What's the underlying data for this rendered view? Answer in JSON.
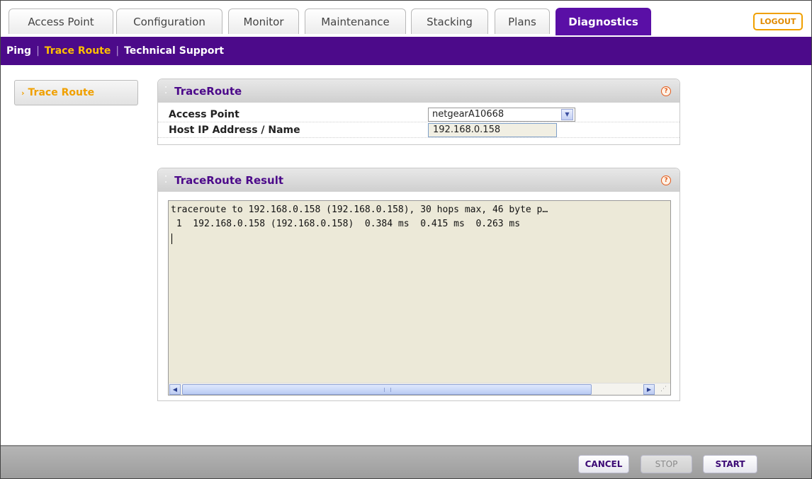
{
  "tabs": [
    {
      "label": "Access Point"
    },
    {
      "label": "Configuration"
    },
    {
      "label": "Monitor"
    },
    {
      "label": "Maintenance"
    },
    {
      "label": "Stacking"
    },
    {
      "label": "Plans"
    },
    {
      "label": "Diagnostics",
      "active": true
    }
  ],
  "logout_label": "LOGOUT",
  "subnav": {
    "items": [
      "Ping",
      "Trace Route",
      "Technical Support"
    ],
    "current": "Trace Route"
  },
  "sidebar": {
    "items": [
      {
        "label": "Trace Route",
        "active": true
      }
    ]
  },
  "traceroute_panel": {
    "title": "TraceRoute",
    "access_point_label": "Access Point",
    "access_point_value": "netgearA10668",
    "host_label": "Host IP Address / Name",
    "host_value": "192.168.0.158"
  },
  "result_panel": {
    "title": "TraceRoute Result",
    "text": "traceroute to 192.168.0.158 (192.168.0.158), 30 hops max, 46 byte p…\n 1  192.168.0.158 (192.168.0.158)  0.384 ms  0.415 ms  0.263 ms\n"
  },
  "footer": {
    "cancel_label": "CANCEL",
    "stop_label": "STOP",
    "start_label": "START"
  },
  "colors": {
    "brand_purple": "#4c0a8a",
    "accent_orange": "#f0a000"
  }
}
